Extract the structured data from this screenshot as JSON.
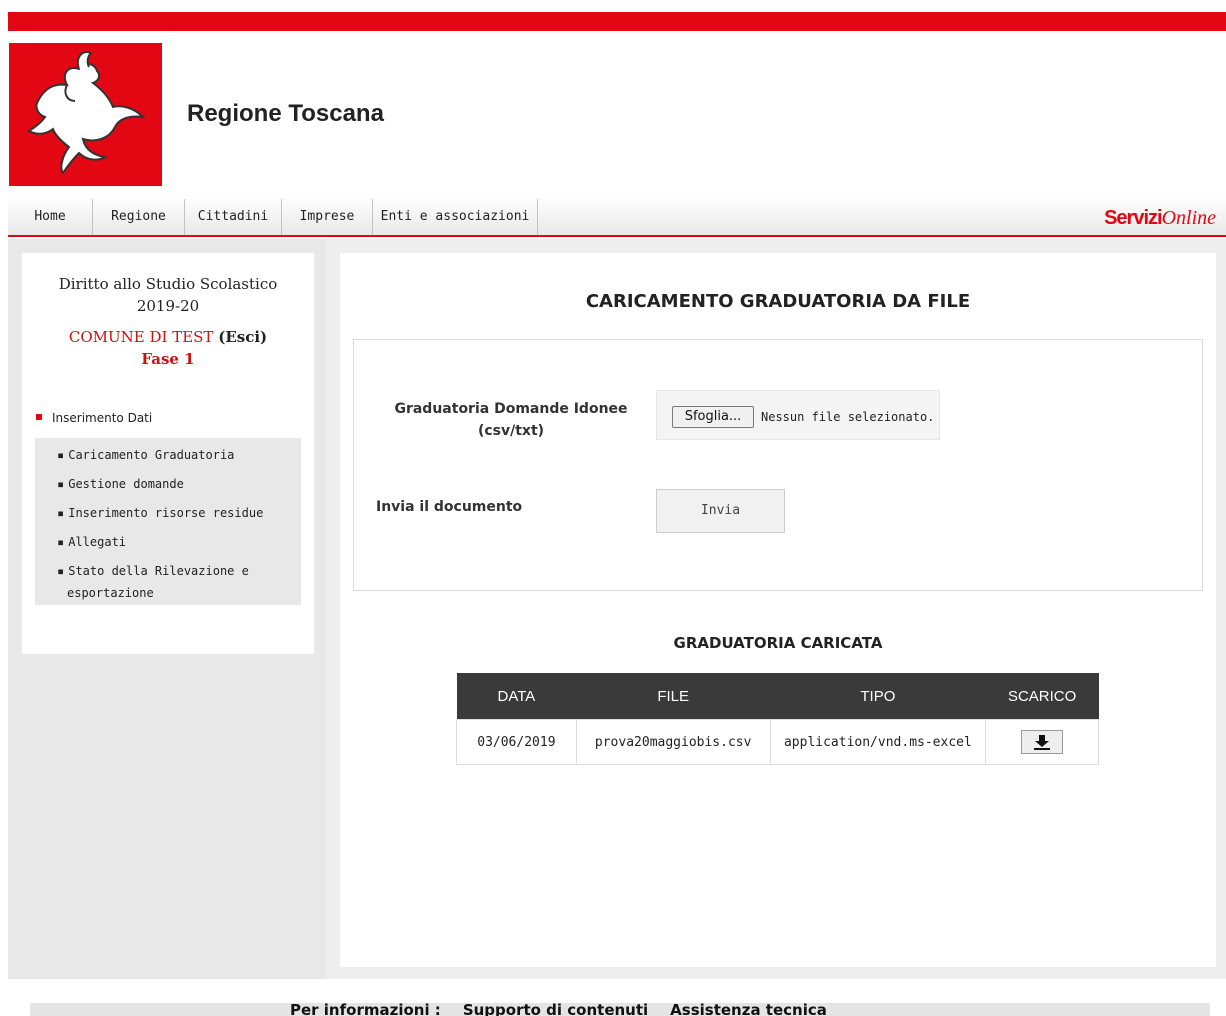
{
  "brand": {
    "name": "Regione Toscana",
    "servizi_bold": "Servizi",
    "servizi_italic": "Online",
    "accent": "#e30613"
  },
  "nav": [
    "Home",
    "Regione",
    "Cittadini",
    "Imprese",
    "Enti e associazioni"
  ],
  "sidebar": {
    "title_line1": "Diritto allo Studio Scolastico",
    "title_line2": "2019-20",
    "comune": "COMUNE DI TEST",
    "esci": "(Esci)",
    "fase": "Fase 1",
    "section": "Inserimento Dati",
    "items": [
      "Caricamento Graduatoria",
      "Gestione domande",
      "Inserimento risorse residue",
      "Allegati",
      "Stato della Rilevazione e",
      "esportazione"
    ]
  },
  "main": {
    "title": "CARICAMENTO GRADUATORIA DA FILE",
    "file_label_line1": "Graduatoria Domande Idonee",
    "file_label_line2": "(csv/txt)",
    "browse_button": "Sfoglia...",
    "no_file": "Nessun file selezionato.",
    "send_label": "Invia il documento",
    "send_button": "Invia",
    "table_title": "GRADUATORIA CARICATA",
    "columns": [
      "DATA",
      "FILE",
      "TIPO",
      "SCARICO"
    ],
    "rows": [
      {
        "data": "03/06/2019",
        "file": "prova20maggiobis.csv",
        "tipo": "application/vnd.ms-excel",
        "scarico_icon": "download-icon"
      }
    ]
  },
  "footer": {
    "info": "Per informazioni :",
    "supporto": "Supporto di contenuti",
    "assistenza": "Assistenza tecnica"
  }
}
